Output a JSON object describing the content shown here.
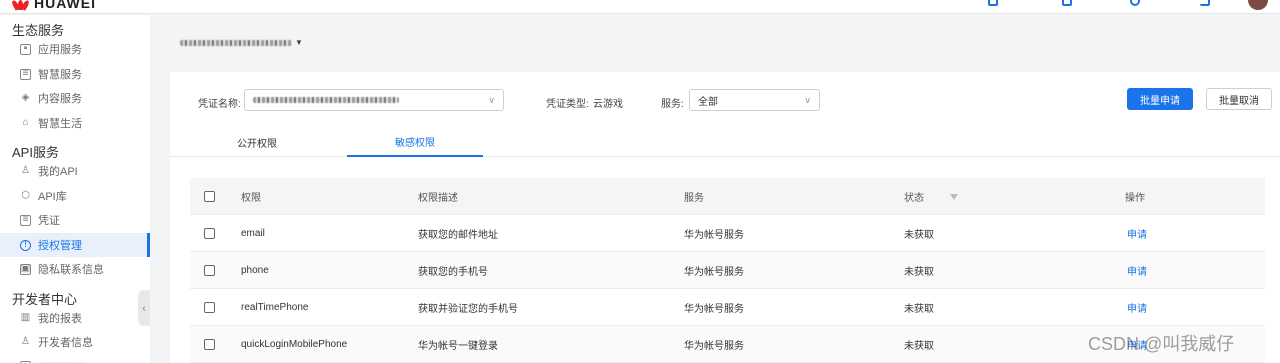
{
  "brand": {
    "logo_text": "HUAWEI"
  },
  "sidebar": {
    "sections": [
      {
        "title": "生态服务"
      },
      {
        "title": "API服务"
      },
      {
        "title": "开发者中心"
      }
    ],
    "items": [
      {
        "label": "应用服务",
        "icon": "app-service-icon"
      },
      {
        "label": "智慧服务",
        "icon": "smart-service-icon"
      },
      {
        "label": "内容服务",
        "icon": "content-service-icon"
      },
      {
        "label": "智慧生活",
        "icon": "smart-life-icon"
      },
      {
        "label": "我的API",
        "icon": "user-icon"
      },
      {
        "label": "API库",
        "icon": "cube-icon"
      },
      {
        "label": "凭证",
        "icon": "credential-icon"
      },
      {
        "label": "授权管理",
        "icon": "shield-icon"
      },
      {
        "label": "隐私联系信息",
        "icon": "privacy-icon"
      },
      {
        "label": "我的报表",
        "icon": "chart-icon"
      },
      {
        "label": "开发者信息",
        "icon": "user-icon"
      }
    ],
    "active_item": "授权管理",
    "collapse_glyph": "‹"
  },
  "filters": {
    "credential_label": "凭证名称:",
    "credential_type_label": "凭证类型:",
    "credential_type_value": "云游戏",
    "service_label": "服务:",
    "service_value": "全部",
    "chevron": "∨",
    "caret": "▼"
  },
  "buttons": {
    "batch_apply": "批量申请",
    "batch_cancel": "批量取消"
  },
  "tabs": [
    {
      "label": "公开权限",
      "active": false
    },
    {
      "label": "敏感权限",
      "active": true
    }
  ],
  "table": {
    "headers": {
      "permission": "权限",
      "description": "权限描述",
      "service": "服务",
      "status": "状态",
      "action": "操作"
    },
    "rows": [
      {
        "permission": "email",
        "description": "获取您的邮件地址",
        "service": "华为帐号服务",
        "status": "未获取",
        "action": "申请"
      },
      {
        "permission": "phone",
        "description": "获取您的手机号",
        "service": "华为帐号服务",
        "status": "未获取",
        "action": "申请"
      },
      {
        "permission": "realTimePhone",
        "description": "获取并验证您的手机号",
        "service": "华为帐号服务",
        "status": "未获取",
        "action": "申请"
      },
      {
        "permission": "quickLoginMobilePhone",
        "description": "华为帐号一键登录",
        "service": "华为帐号服务",
        "status": "未获取",
        "action": "申请"
      }
    ]
  },
  "watermark": "CSDN @叫我威仔",
  "colors": {
    "accent": "#1a73e8",
    "brand_red": "#e22222"
  }
}
